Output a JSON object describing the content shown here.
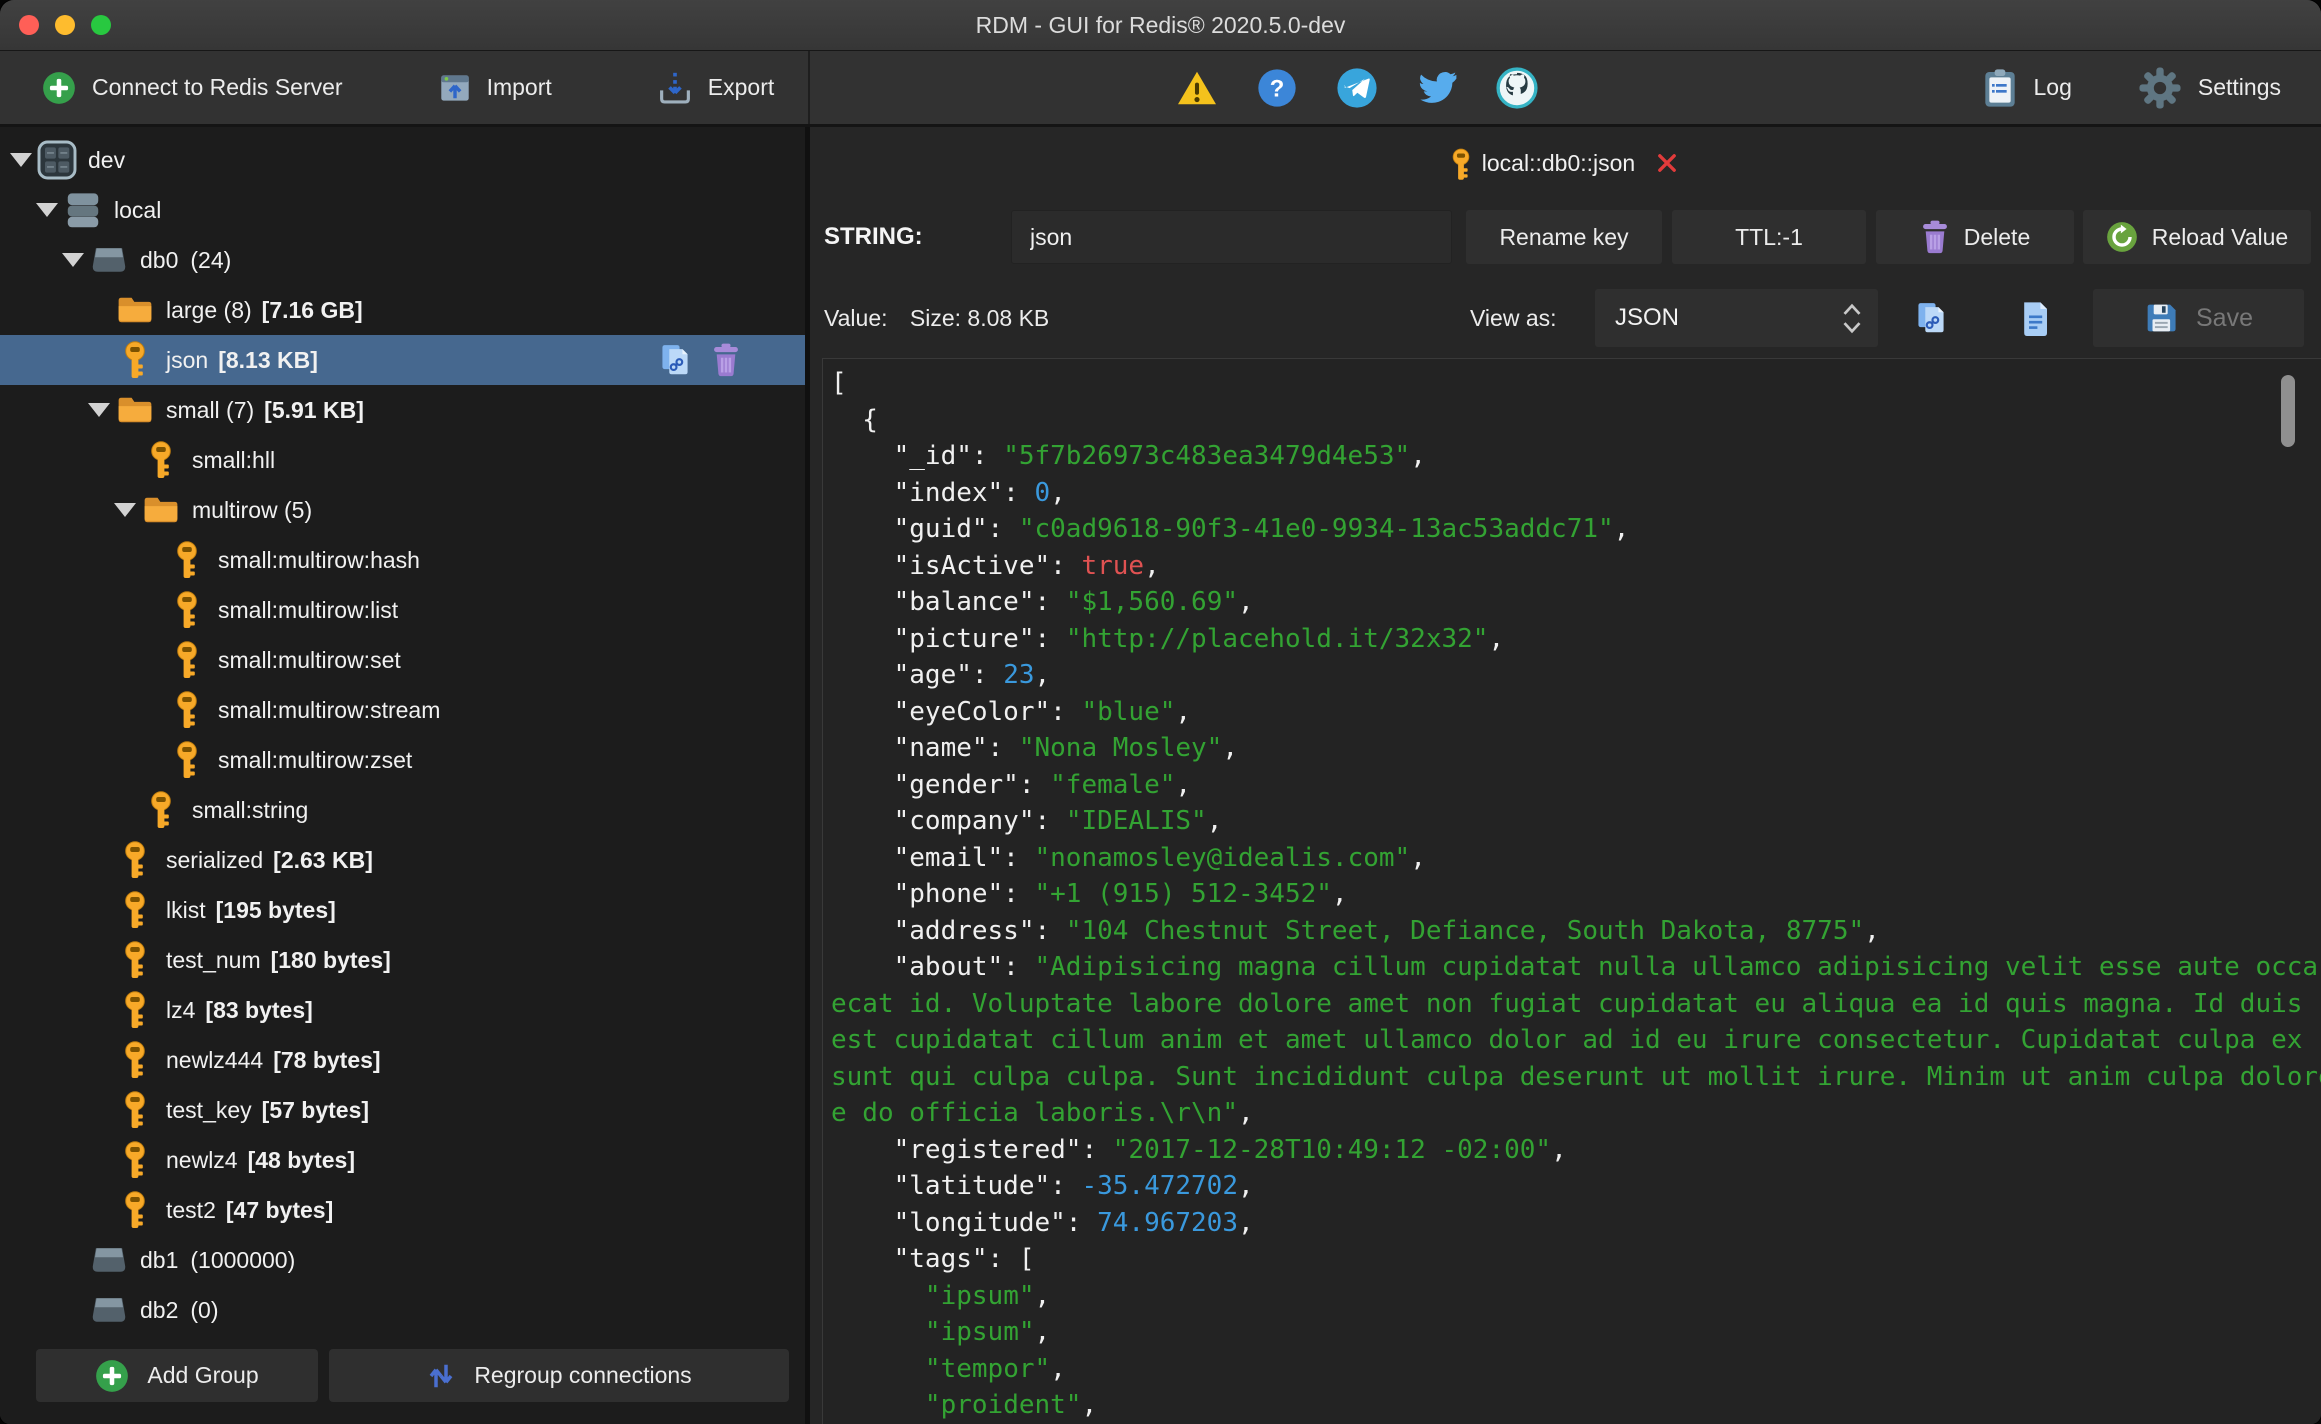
{
  "window": {
    "title": "RDM - GUI for Redis® 2020.5.0-dev"
  },
  "toolbar": {
    "connect_label": "Connect to Redis Server",
    "import_label": "Import",
    "export_label": "Export",
    "log_label": "Log",
    "settings_label": "Settings",
    "status_icons": [
      "warning-icon",
      "help-icon",
      "telegram-icon",
      "twitter-icon",
      "github-icon"
    ]
  },
  "sidebar": {
    "tree": [
      {
        "icon": "connection-group-icon",
        "label": "dev",
        "level": 0,
        "expanded": true
      },
      {
        "icon": "server-icon",
        "label": "local",
        "level": 1,
        "expanded": true
      },
      {
        "icon": "database-icon",
        "label": "db0",
        "count": "(24)",
        "level": 2,
        "expanded": true
      },
      {
        "icon": "folder-icon",
        "label": "large (8)",
        "size": "[7.16 GB]",
        "level": 3
      },
      {
        "icon": "key-icon",
        "label": "json",
        "size": "[8.13 KB]",
        "level": 3,
        "selected": true,
        "actions": [
          "copy-link-icon",
          "trash-icon"
        ]
      },
      {
        "icon": "folder-icon",
        "label": "small (7)",
        "size": "[5.91 KB]",
        "level": 3,
        "expanded": true
      },
      {
        "icon": "key-icon",
        "label": "small:hll",
        "level": 4
      },
      {
        "icon": "folder-icon",
        "label": "multirow (5)",
        "level": 4,
        "expanded": true
      },
      {
        "icon": "key-icon",
        "label": "small:multirow:hash",
        "level": 5
      },
      {
        "icon": "key-icon",
        "label": "small:multirow:list",
        "level": 5
      },
      {
        "icon": "key-icon",
        "label": "small:multirow:set",
        "level": 5
      },
      {
        "icon": "key-icon",
        "label": "small:multirow:stream",
        "level": 5
      },
      {
        "icon": "key-icon",
        "label": "small:multirow:zset",
        "level": 5
      },
      {
        "icon": "key-icon",
        "label": "small:string",
        "level": 4
      },
      {
        "icon": "key-icon",
        "label": "serialized",
        "size": "[2.63 KB]",
        "level": 3
      },
      {
        "icon": "key-icon",
        "label": "lkist",
        "size": "[195 bytes]",
        "level": 3
      },
      {
        "icon": "key-icon",
        "label": "test_num",
        "size": "[180 bytes]",
        "level": 3
      },
      {
        "icon": "key-icon",
        "label": "lz4",
        "size": "[83 bytes]",
        "level": 3
      },
      {
        "icon": "key-icon",
        "label": "newlz444",
        "size": "[78 bytes]",
        "level": 3
      },
      {
        "icon": "key-icon",
        "label": "test_key",
        "size": "[57 bytes]",
        "level": 3
      },
      {
        "icon": "key-icon",
        "label": "newlz4",
        "size": "[48 bytes]",
        "level": 3
      },
      {
        "icon": "key-icon",
        "label": "test2",
        "size": "[47 bytes]",
        "level": 3
      },
      {
        "icon": "database-icon",
        "label": "db1",
        "count": "(1000000)",
        "level": 2
      },
      {
        "icon": "database-icon",
        "label": "db2",
        "count": "(0)",
        "level": 2
      }
    ],
    "add_group_label": "Add Group",
    "regroup_label": "Regroup connections"
  },
  "main": {
    "tab": {
      "icon": "key-icon",
      "title": "local::db0::json"
    },
    "key_row": {
      "type_label": "STRING:",
      "key_value": "json",
      "rename_label": "Rename key",
      "ttl_label": "TTL:-1",
      "delete_label": "Delete",
      "reload_label": "Reload Value"
    },
    "value_row": {
      "value_label": "Value:",
      "size_label": "Size: 8.08 KB",
      "view_as_label": "View as:",
      "format_value": "JSON",
      "save_label": "Save"
    },
    "editor": {
      "lines": [
        [
          {
            "c": "w",
            "t": "["
          }
        ],
        [
          {
            "c": "w",
            "t": "  {"
          }
        ],
        [
          {
            "c": "w",
            "t": "    \"_id\": "
          },
          {
            "c": "s",
            "t": "\"5f7b26973c483ea3479d4e53\""
          },
          {
            "c": "w",
            "t": ","
          }
        ],
        [
          {
            "c": "w",
            "t": "    \"index\": "
          },
          {
            "c": "n",
            "t": "0"
          },
          {
            "c": "w",
            "t": ","
          }
        ],
        [
          {
            "c": "w",
            "t": "    \"guid\": "
          },
          {
            "c": "s",
            "t": "\"c0ad9618-90f3-41e0-9934-13ac53addc71\""
          },
          {
            "c": "w",
            "t": ","
          }
        ],
        [
          {
            "c": "w",
            "t": "    \"isActive\": "
          },
          {
            "c": "b",
            "t": "true"
          },
          {
            "c": "w",
            "t": ","
          }
        ],
        [
          {
            "c": "w",
            "t": "    \"balance\": "
          },
          {
            "c": "s",
            "t": "\"$1,560.69\""
          },
          {
            "c": "w",
            "t": ","
          }
        ],
        [
          {
            "c": "w",
            "t": "    \"picture\": "
          },
          {
            "c": "s",
            "t": "\"http://placehold.it/32x32\""
          },
          {
            "c": "w",
            "t": ","
          }
        ],
        [
          {
            "c": "w",
            "t": "    \"age\": "
          },
          {
            "c": "n",
            "t": "23"
          },
          {
            "c": "w",
            "t": ","
          }
        ],
        [
          {
            "c": "w",
            "t": "    \"eyeColor\": "
          },
          {
            "c": "s",
            "t": "\"blue\""
          },
          {
            "c": "w",
            "t": ","
          }
        ],
        [
          {
            "c": "w",
            "t": "    \"name\": "
          },
          {
            "c": "s",
            "t": "\"Nona Mosley\""
          },
          {
            "c": "w",
            "t": ","
          }
        ],
        [
          {
            "c": "w",
            "t": "    \"gender\": "
          },
          {
            "c": "s",
            "t": "\"female\""
          },
          {
            "c": "w",
            "t": ","
          }
        ],
        [
          {
            "c": "w",
            "t": "    \"company\": "
          },
          {
            "c": "s",
            "t": "\"IDEALIS\""
          },
          {
            "c": "w",
            "t": ","
          }
        ],
        [
          {
            "c": "w",
            "t": "    \"email\": "
          },
          {
            "c": "s",
            "t": "\"nonamosley@idealis.com\""
          },
          {
            "c": "w",
            "t": ","
          }
        ],
        [
          {
            "c": "w",
            "t": "    \"phone\": "
          },
          {
            "c": "s",
            "t": "\"+1 (915) 512-3452\""
          },
          {
            "c": "w",
            "t": ","
          }
        ],
        [
          {
            "c": "w",
            "t": "    \"address\": "
          },
          {
            "c": "s",
            "t": "\"104 Chestnut Street, Defiance, South Dakota, 8775\""
          },
          {
            "c": "w",
            "t": ","
          }
        ],
        [
          {
            "c": "w",
            "t": "    \"about\": "
          },
          {
            "c": "s",
            "t": "\"Adipisicing magna cillum cupidatat nulla ullamco adipisicing velit esse aute occa"
          }
        ],
        [
          {
            "c": "s",
            "t": "ecat id. Voluptate labore dolore amet non fugiat cupidatat eu aliqua ea id quis magna. Id duis "
          }
        ],
        [
          {
            "c": "s",
            "t": "est cupidatat cillum anim et amet ullamco dolor ad id eu irure consectetur. Cupidatat culpa ex "
          }
        ],
        [
          {
            "c": "s",
            "t": "sunt qui culpa culpa. Sunt incididunt culpa deserunt ut mollit irure. Minim ut anim culpa dolore"
          }
        ],
        [
          {
            "c": "s",
            "t": "e do officia laboris.\\r\\n\""
          },
          {
            "c": "w",
            "t": ","
          }
        ],
        [
          {
            "c": "w",
            "t": "    \"registered\": "
          },
          {
            "c": "s",
            "t": "\"2017-12-28T10:49:12 -02:00\""
          },
          {
            "c": "w",
            "t": ","
          }
        ],
        [
          {
            "c": "w",
            "t": "    \"latitude\": "
          },
          {
            "c": "n",
            "t": "-35.472702"
          },
          {
            "c": "w",
            "t": ","
          }
        ],
        [
          {
            "c": "w",
            "t": "    \"longitude\": "
          },
          {
            "c": "n",
            "t": "74.967203"
          },
          {
            "c": "w",
            "t": ","
          }
        ],
        [
          {
            "c": "w",
            "t": "    \"tags\": ["
          }
        ],
        [
          {
            "c": "w",
            "t": "      "
          },
          {
            "c": "s",
            "t": "\"ipsum\""
          },
          {
            "c": "w",
            "t": ","
          }
        ],
        [
          {
            "c": "w",
            "t": "      "
          },
          {
            "c": "s",
            "t": "\"ipsum\""
          },
          {
            "c": "w",
            "t": ","
          }
        ],
        [
          {
            "c": "w",
            "t": "      "
          },
          {
            "c": "s",
            "t": "\"tempor\""
          },
          {
            "c": "w",
            "t": ","
          }
        ],
        [
          {
            "c": "w",
            "t": "      "
          },
          {
            "c": "s",
            "t": "\"proident\""
          },
          {
            "c": "w",
            "t": ","
          }
        ]
      ]
    }
  },
  "colors": {
    "selection_blue": "#46688f",
    "key_orange": "#f7a928",
    "string_green": "#33a333",
    "number_blue": "#3a99dd",
    "bool_red": "#e05252"
  }
}
